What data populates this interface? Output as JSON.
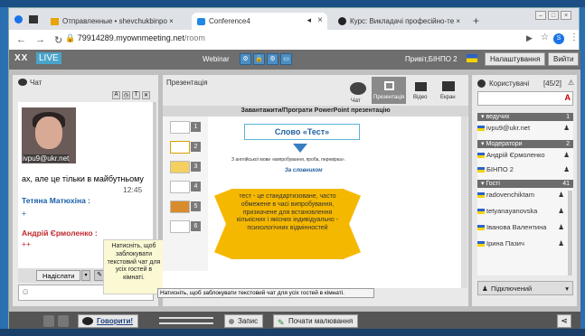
{
  "browser": {
    "tabs": [
      {
        "label": "Отправленные • shevchukbinpo ×"
      },
      {
        "label": "Conference4"
      },
      {
        "label": "Курс: Викладачі професійно-те ×"
      }
    ],
    "url_base": "79914289.myownmeeting.net",
    "url_path": "/room"
  },
  "app": {
    "logo": "XX",
    "live": "LIVE",
    "webinar": "Webinar",
    "greeting": "Привіт,БІНПО 2",
    "settings_btn": "Налаштування",
    "exit_btn": "Вийти"
  },
  "chat": {
    "title": "Чат",
    "video_caption": "ivpu9@ukr.net",
    "partial_msg": "ах, але це тільки в майбутньому",
    "time": "12:45",
    "user1": "Тетяна Матюхіна :",
    "user2": "Андрій Єрмоленко :",
    "send_btn": "Надіслати",
    "tooltip": "Натисніть, щоб заблокувати текстовий чат для усіх гостей в кімнаті.",
    "bottom_hint": "Натисніть, щоб заблокувати текстовий чат для усіх гостей в кімнаті."
  },
  "presentation": {
    "title": "Презентація",
    "mode_presentation": "Презентація",
    "mode_video": "Відео",
    "mode_screen": "Екран",
    "chat_mode": "Чат",
    "upload_bar": "Завантажити/Програти PowerPoint презентацію",
    "slide_title": "Слово «Тест»",
    "slide_line1": "З англійської мови «випробування, проба, перевірка».",
    "slide_line2": "За словником",
    "slide_banner": "тест - це стандартизоване, часто обмежене в часі випробування, призначене для встановлення кількісних і якісних індивідуально - психологічних відмінностей",
    "thumb_numbers": [
      "1",
      "2",
      "3",
      "4",
      "5",
      "6"
    ]
  },
  "users": {
    "title": "Користувачі",
    "count": "[45/2]",
    "section_host": "ведучих",
    "section_host_count": "1",
    "host_user": "ivpu9@ukr.net",
    "section_mod": "Модератори",
    "section_mod_count": "2",
    "mod_users": [
      "Андрій Єрмоленко",
      "БІНПО 2"
    ],
    "section_guests": "Гості",
    "section_guests_count": "41",
    "guest_users": [
      "radovenchiktam",
      "tetyanayanovska",
      "Іванова Валентина",
      "Ірина Пазич"
    ],
    "connected": "Підключений"
  },
  "bottom": {
    "talk_btn": "Говорити!",
    "record_btn": "Запис",
    "draw_btn": "Почати малювання"
  },
  "colors": {
    "accent": "#4c8fc4",
    "appbar": "#6e6e6e",
    "banner": "#f5b800"
  }
}
